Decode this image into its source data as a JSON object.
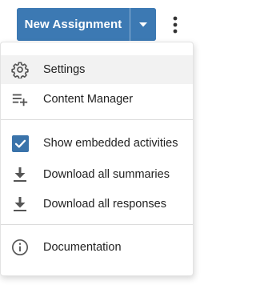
{
  "toolbar": {
    "new_assignment_label": "New Assignment",
    "dropdown_icon": "caret-down-icon",
    "more_icon": "kebab-icon"
  },
  "menu": {
    "settings": {
      "label": "Settings",
      "icon": "gear-icon"
    },
    "content_manager": {
      "label": "Content Manager",
      "icon": "list-add-icon"
    },
    "show_embedded": {
      "label": "Show embedded activities",
      "icon": "checkbox-icon",
      "checked": true
    },
    "download_summaries": {
      "label": "Download all summaries",
      "icon": "download-icon"
    },
    "download_responses": {
      "label": "Download all responses",
      "icon": "download-icon"
    },
    "documentation": {
      "label": "Documentation",
      "icon": "info-icon"
    }
  },
  "colors": {
    "primary": "#3c79b3",
    "checkbox": "#3a73aa",
    "text": "#222222",
    "icon": "#555555",
    "hover": "#f2f2f2"
  }
}
